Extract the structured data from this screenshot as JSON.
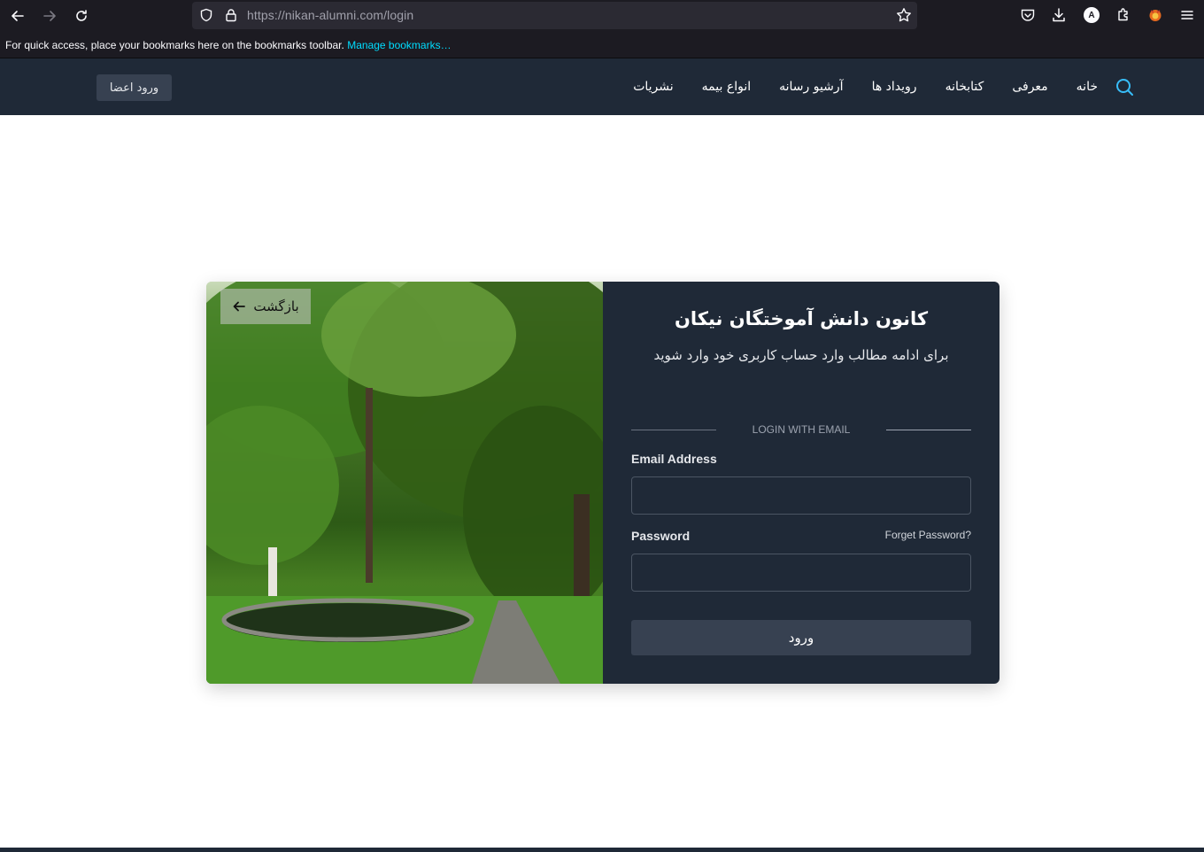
{
  "browser": {
    "url_host": "https://nikan-alumni.com",
    "url_path": "/login",
    "bookmarks_text": "For quick access, place your bookmarks here on the bookmarks toolbar.",
    "bookmarks_link": "Manage bookmarks…",
    "profile_initial": "A"
  },
  "nav": {
    "items": [
      {
        "label": "خانه"
      },
      {
        "label": "معرفی"
      },
      {
        "label": "کتابخانه"
      },
      {
        "label": "رویداد ها"
      },
      {
        "label": "آرشیو رسانه"
      },
      {
        "label": "انواع بیمه"
      },
      {
        "label": "نشریات"
      }
    ],
    "login_button": "ورود اعضا",
    "accent_color": "#38bdf8"
  },
  "card": {
    "back_label": "بازگشت",
    "title": "کانون دانش آموختگان نیکان",
    "subtitle": "برای ادامه مطالب وارد حساب کاربری خود وارد شوید",
    "divider_label": "LOGIN WITH EMAIL",
    "email_label": "Email Address",
    "email_value": "",
    "password_label": "Password",
    "password_value": "",
    "forgot_label": "Forget Password?",
    "submit_label": "ورود"
  }
}
